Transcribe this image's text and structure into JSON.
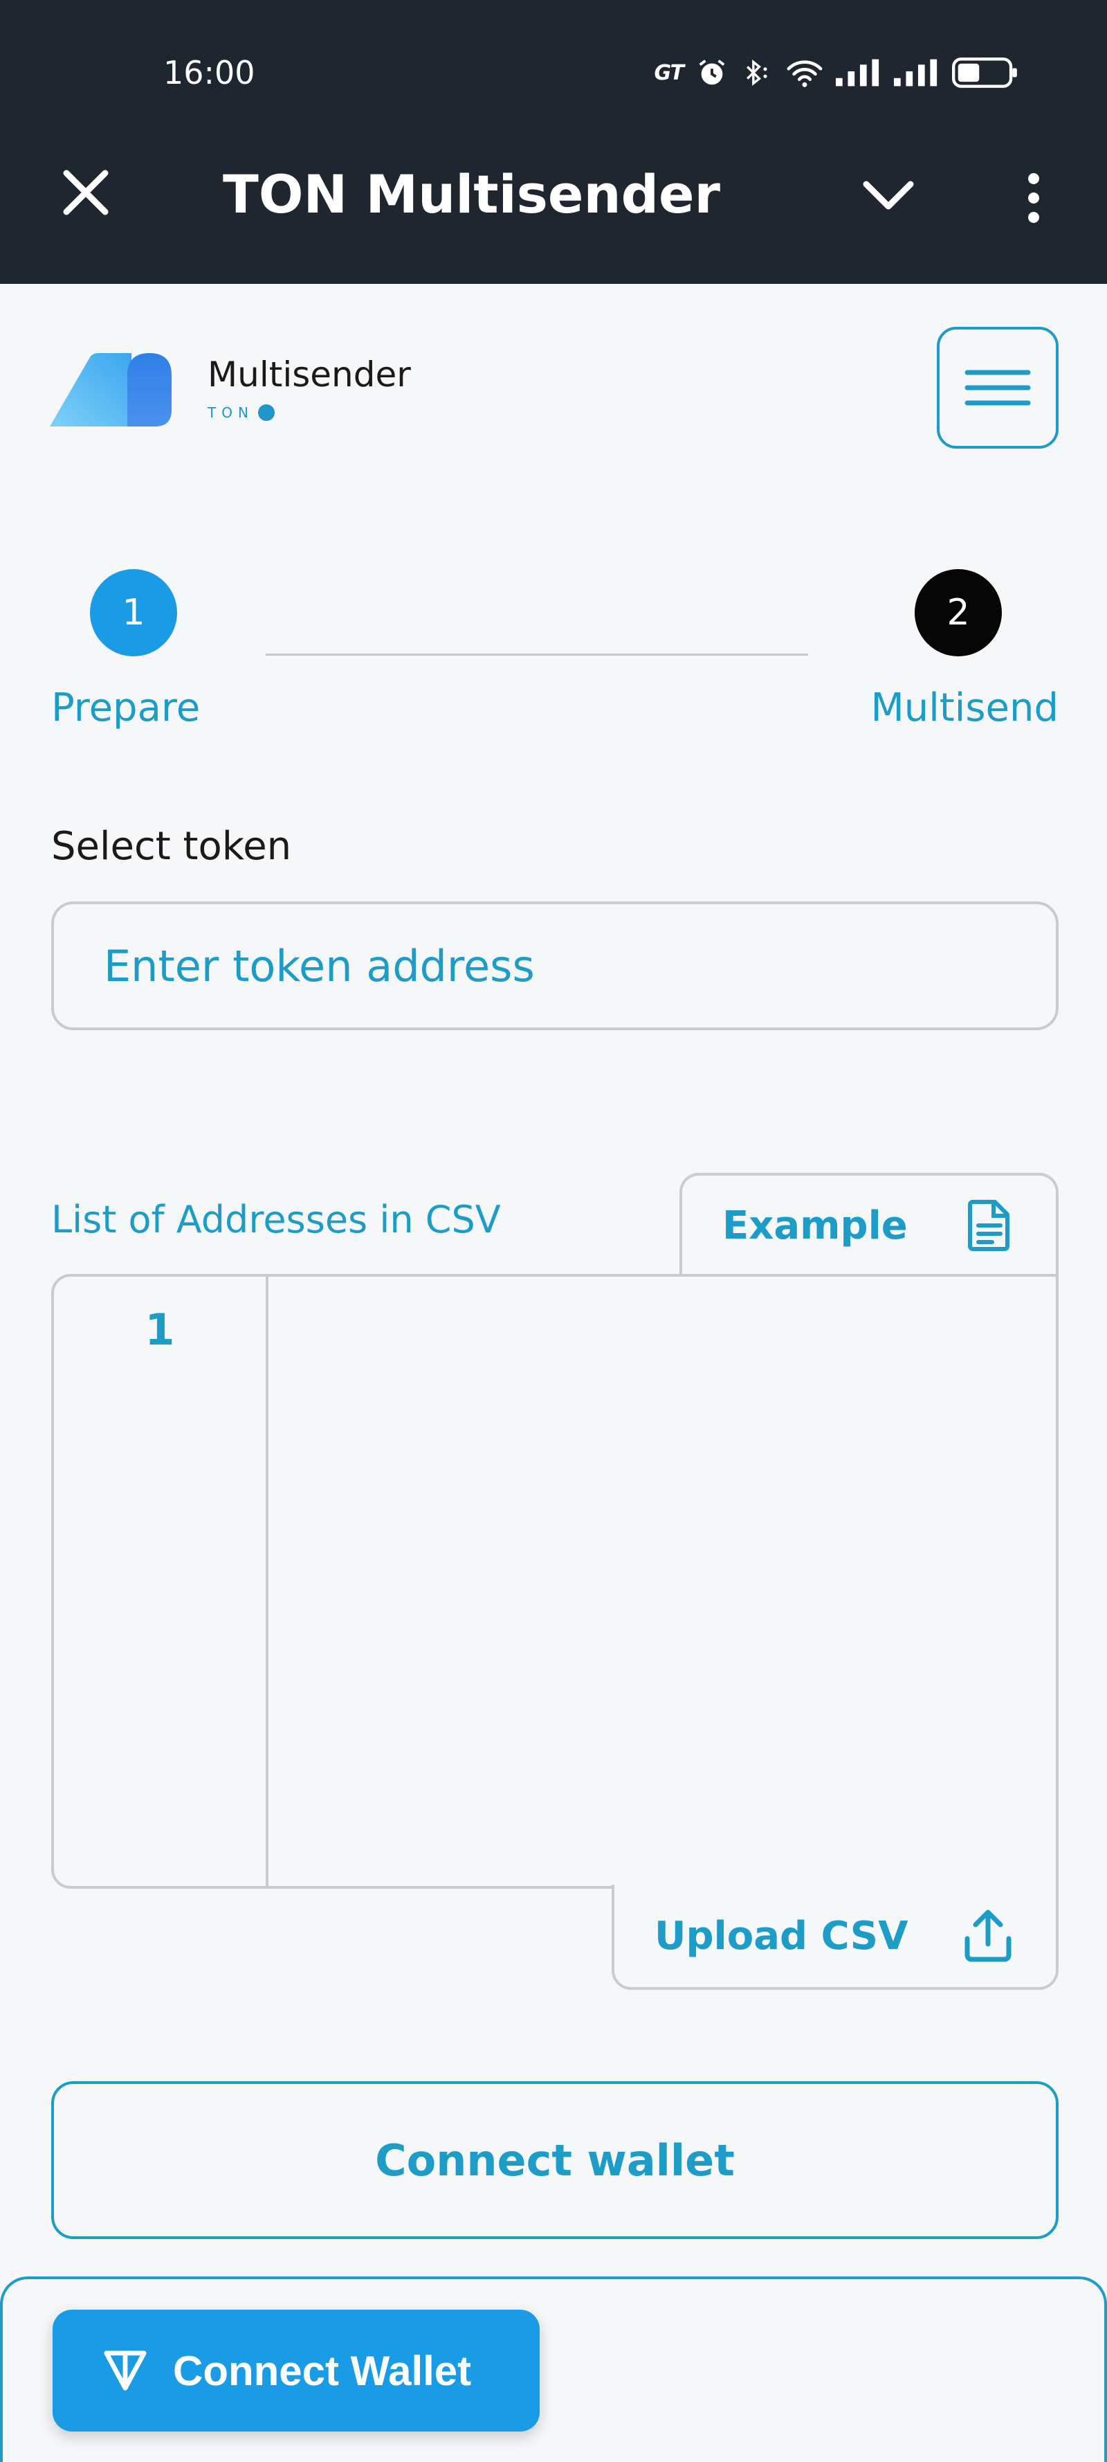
{
  "status_bar": {
    "time": "16:00",
    "carrier_tag": "GT"
  },
  "header": {
    "title": "TON Multisender"
  },
  "brand": {
    "name": "Multisender",
    "sub": "TON"
  },
  "stepper": {
    "steps": [
      {
        "number": "1",
        "label": "Prepare",
        "state": "active"
      },
      {
        "number": "2",
        "label": "Multisend",
        "state": "pending"
      }
    ]
  },
  "token": {
    "label": "Select token",
    "placeholder": "Enter token address",
    "value": ""
  },
  "csv": {
    "label": "List of Addresses in CSV",
    "example_label": "Example",
    "line_numbers": [
      "1"
    ],
    "content": "",
    "upload_label": "Upload CSV"
  },
  "actions": {
    "connect_label": "Connect wallet"
  },
  "ton_connect": {
    "label": "Connect Wallet"
  },
  "colors": {
    "accent": "#1e9cc8",
    "primary_button": "#1a9be6",
    "header_bg": "#1f2630",
    "page_bg": "#f5f7f9",
    "border": "#c8cccf"
  }
}
